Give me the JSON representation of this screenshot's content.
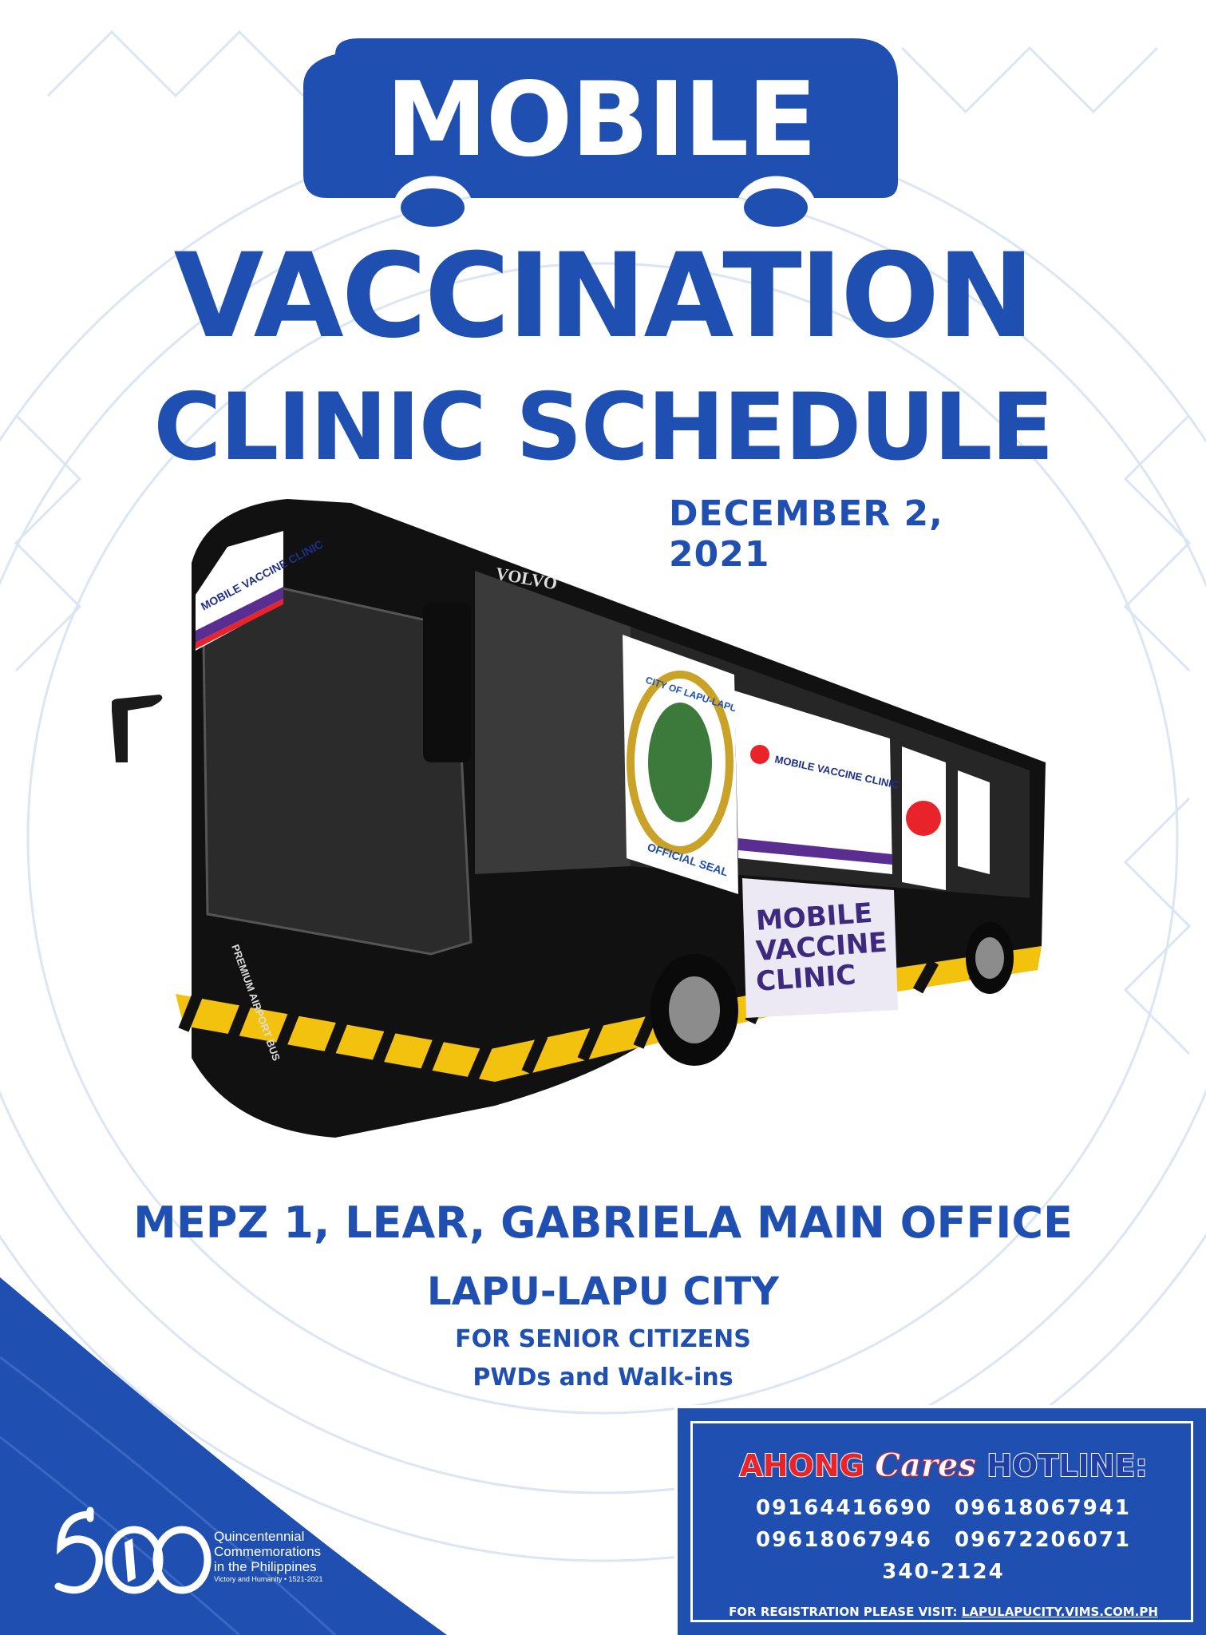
{
  "header": {
    "badge_word": "MOBILE",
    "title_line1": "VACCINATION",
    "title_line2": "CLINIC SCHEDULE",
    "date": "DECEMBER 2, 2021"
  },
  "location": {
    "line1": "MEPZ 1, LEAR, GABRIELA MAIN OFFICE",
    "line2": "LAPU-LAPU CITY",
    "audience1": "FOR SENIOR CITIZENS",
    "audience2": "PWDs and Walk-ins"
  },
  "bus": {
    "brand": "VOLVO",
    "banner_top": "MOBILE VACCINE CLINIC",
    "seal_text": "CITY OF LAPU-LAPU",
    "seal_bottom": "OFFICIAL SEAL",
    "side_banner": "MOBILE VACCINE CLINIC",
    "big_banner_line1": "MOBILE",
    "big_banner_line2": "VACCINE",
    "big_banner_line3": "CLINIC",
    "front_label": "PREMIUM AIRPORT BUS"
  },
  "logo": {
    "line1": "Quincentennial",
    "line2": "Commemorations",
    "line3": "in the Philippines",
    "tagline": "Victory and Humanity • 1521-2021"
  },
  "hotline": {
    "ahong": "AHONG",
    "cares": "Cares",
    "hotline_word": "HOTLINE:",
    "numbers_row1": [
      "09164416690",
      "09618067941"
    ],
    "numbers_row2": [
      "09618067946",
      "09672206071"
    ],
    "number_landline": "340-2124",
    "registration_prefix": "FOR REGISTRATION PLEASE VISIT:",
    "registration_url": "LAPULAPUCITY.VIMS.COM.PH"
  },
  "colors": {
    "brand_blue": "#1f4fb0",
    "ahong_red": "#e8232a",
    "hazard_yellow": "#f2c20f"
  }
}
